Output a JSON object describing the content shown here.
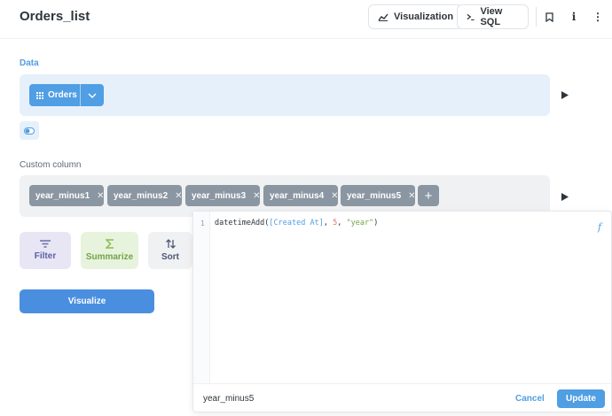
{
  "header": {
    "title": "Orders_list",
    "visualization_label": "Visualization",
    "view_sql_label": "View SQL",
    "info_glyph": "i",
    "more_glyph": "⋮"
  },
  "data_section": {
    "label": "Data",
    "source_label": "Orders"
  },
  "custom_column": {
    "label": "Custom column",
    "pills": [
      {
        "label": "year_minus1"
      },
      {
        "label": "year_minus2"
      },
      {
        "label": "year_minus3"
      },
      {
        "label": "year_minus4"
      },
      {
        "label": "year_minus5"
      }
    ],
    "add_glyph": "+",
    "remove_glyph": "✕"
  },
  "actions": {
    "filter_label": "Filter",
    "summarize_label": "Summarize",
    "sort_label": "Sort",
    "visualize_label": "Visualize"
  },
  "editor": {
    "line_number": "1",
    "code_func": "datetimeAdd(",
    "code_field": "[Created At]",
    "code_sep1": ", ",
    "code_num": "5",
    "code_sep2": ", ",
    "code_str": "\"year\"",
    "code_end": ")",
    "func_glyph": "f",
    "name_value": "year_minus5",
    "cancel_label": "Cancel",
    "update_label": "Update"
  },
  "colors": {
    "brand": "#509ee3",
    "filter": "#7172ad",
    "summarize": "#88bf4d",
    "pill_gray": "#8a96a1"
  },
  "icons": {
    "visualization": "chart-line-icon",
    "view_sql": "terminal-icon",
    "bookmark": "bookmark-icon",
    "info": "info-icon",
    "more": "more-vertical-icon",
    "data_grid": "grid-icon",
    "chevron": "chevron-down-icon",
    "play": "play-icon",
    "toggle": "toggle-icon",
    "filter": "filter-icon",
    "summarize": "sigma-icon",
    "sort": "sort-icon",
    "function": "function-icon"
  }
}
